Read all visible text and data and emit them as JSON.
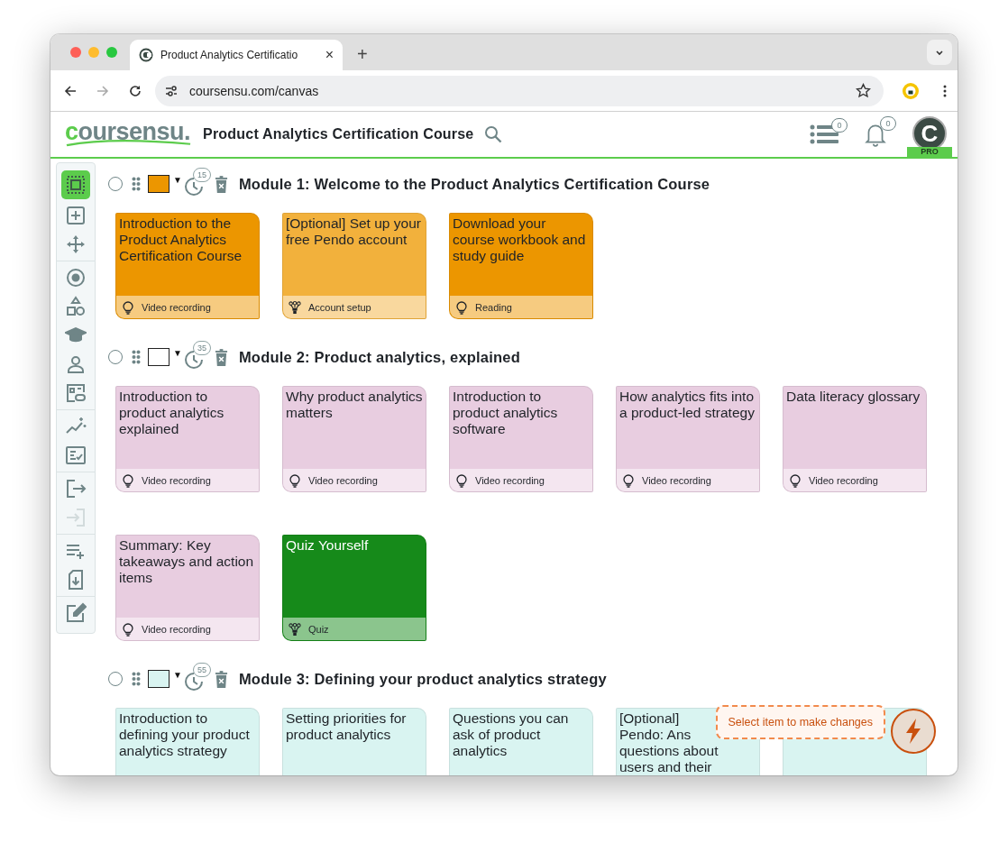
{
  "browser": {
    "tab_title": "Product Analytics Certificatio",
    "tab_close": "×",
    "new_tab": "+",
    "url": "coursensu.com/canvas"
  },
  "app": {
    "logo": {
      "first": "c",
      "rest": "oursensu."
    },
    "course_title": "Product Analytics Certification Course",
    "list_count": "0",
    "notification_count": "0",
    "avatar_letter": "C",
    "plan": "PRO"
  },
  "tools": [
    [
      {
        "kind": "select",
        "selected": true,
        "disabled": false
      },
      {
        "kind": "add",
        "selected": false,
        "disabled": false
      },
      {
        "kind": "move",
        "selected": false,
        "disabled": false
      }
    ],
    [
      {
        "kind": "target",
        "selected": false,
        "disabled": false
      },
      {
        "kind": "shapes",
        "selected": false,
        "disabled": false
      },
      {
        "kind": "cap",
        "selected": false,
        "disabled": false
      },
      {
        "kind": "person",
        "selected": false,
        "disabled": false
      },
      {
        "kind": "linkcard",
        "selected": false,
        "disabled": false
      }
    ],
    [
      {
        "kind": "chart",
        "selected": false,
        "disabled": false
      },
      {
        "kind": "checklist",
        "selected": false,
        "disabled": false
      }
    ],
    [
      {
        "kind": "export",
        "selected": false,
        "disabled": false
      },
      {
        "kind": "import",
        "selected": false,
        "disabled": true
      }
    ],
    [
      {
        "kind": "listadd",
        "selected": false,
        "disabled": false
      },
      {
        "kind": "download",
        "selected": false,
        "disabled": false
      }
    ],
    [
      {
        "kind": "edit",
        "selected": false,
        "disabled": false
      }
    ]
  ],
  "modules": [
    {
      "title": "Module 1: Welcome to the Product Analytics Certification Course",
      "selected": false,
      "color": "#ec9600",
      "caret": "▼",
      "minutes": "15",
      "items": [
        {
          "title": "Introduction to the Product Analytics Certification Course",
          "type": "Video recording",
          "kind": "lesson",
          "color": "#ec9600"
        },
        {
          "title": "[Optional] Set up your free Pendo account",
          "type": "Account setup",
          "kind": "activity",
          "color": "#f2b13c"
        },
        {
          "title": "Download your course workbook and study guide",
          "type": "Reading",
          "kind": "lesson",
          "color": "#ec9600"
        }
      ]
    },
    {
      "title": "Module 2: Product analytics, explained",
      "selected": false,
      "color": "#ffffff",
      "caret": "▼",
      "minutes": "35",
      "items": [
        {
          "title": "Introduction to product analytics explained",
          "type": "Video recording",
          "kind": "lesson",
          "color": "#e8cde0"
        },
        {
          "title": "Why product analytics matters",
          "type": "Video recording",
          "kind": "lesson",
          "color": "#e8cde0"
        },
        {
          "title": "Introduction to product analytics software",
          "type": "Video recording",
          "kind": "lesson",
          "color": "#e8cde0"
        },
        {
          "title": "How analytics fits into a product-led strategy",
          "type": "Video recording",
          "kind": "lesson",
          "color": "#e8cde0"
        },
        {
          "title": "Data literacy glossary",
          "type": "Video recording",
          "kind": "lesson",
          "color": "#e8cde0"
        },
        {
          "title": "Summary: Key takeaways and action items",
          "type": "Video recording",
          "kind": "lesson",
          "color": "#e8cde0"
        },
        {
          "title": "Quiz Yourself",
          "type": "Quiz",
          "kind": "activity",
          "color": "#168a1a"
        }
      ]
    },
    {
      "title": "Module 3: Defining your product analytics strategy",
      "selected": false,
      "color": "#d9f4f1",
      "caret": "▼",
      "minutes": "55",
      "items": [
        {
          "title": "Introduction to defining your product analytics strategy",
          "color": "#d9f4f1"
        },
        {
          "title": "Setting priorities for product analytics",
          "color": "#d9f4f1"
        },
        {
          "title": "Questions you can ask of product analytics",
          "color": "#d9f4f1"
        },
        {
          "title_lines": [
            "[Optional]",
            "Pendo: Ans",
            "questions about",
            "users and their"
          ],
          "color": "#d9f4f1"
        },
        {
          "color": "#d9f4f1"
        }
      ]
    }
  ],
  "toast": "Select item to make changes"
}
